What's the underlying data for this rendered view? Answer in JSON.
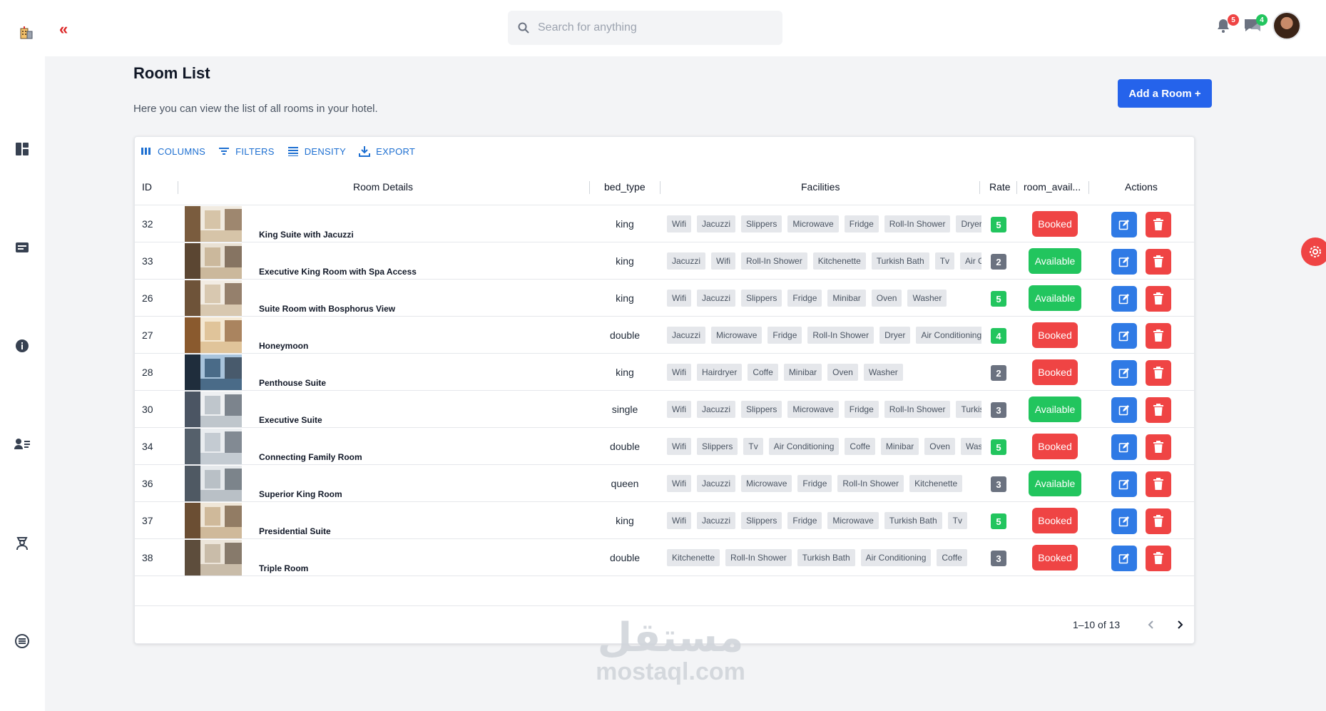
{
  "search": {
    "placeholder": "Search for anything"
  },
  "notifications": {
    "bell_count": "5",
    "chat_count": "4"
  },
  "page": {
    "title": "Room List",
    "subtitle": "Here you can view the list of all rooms in your hotel.",
    "add_button": "Add a Room +"
  },
  "toolbar": {
    "columns": "COLUMNS",
    "filters": "FILTERS",
    "density": "DENSITY",
    "export": "EXPORT"
  },
  "table": {
    "headers": {
      "id": "ID",
      "details": "Room Details",
      "bed": "bed_type",
      "facilities": "Facilities",
      "rate": "Rate",
      "avail": "room_avail...",
      "actions": "Actions"
    },
    "rows": [
      {
        "id": "32",
        "name": "King Suite with Jacuzzi",
        "bed": "king",
        "facilities": [
          "Wifi",
          "Jacuzzi",
          "Slippers",
          "Microwave",
          "Fridge",
          "Roll-In Shower",
          "Dryer"
        ],
        "rate": "5",
        "status": "Booked"
      },
      {
        "id": "33",
        "name": "Executive King Room with Spa Access",
        "bed": "king",
        "facilities": [
          "Jacuzzi",
          "Wifi",
          "Roll-In Shower",
          "Kitchenette",
          "Turkish Bath",
          "Tv",
          "Air Conditioning"
        ],
        "rate": "2",
        "status": "Available"
      },
      {
        "id": "26",
        "name": "Suite Room with Bosphorus View",
        "bed": "king",
        "facilities": [
          "Wifi",
          "Jacuzzi",
          "Slippers",
          "Fridge",
          "Minibar",
          "Oven",
          "Washer"
        ],
        "rate": "5",
        "status": "Available"
      },
      {
        "id": "27",
        "name": "Honeymoon",
        "bed": "double",
        "facilities": [
          "Jacuzzi",
          "Microwave",
          "Fridge",
          "Roll-In Shower",
          "Dryer",
          "Air Conditioning"
        ],
        "rate": "4",
        "status": "Booked"
      },
      {
        "id": "28",
        "name": "Penthouse Suite",
        "bed": "king",
        "facilities": [
          "Wifi",
          "Hairdryer",
          "Coffe",
          "Minibar",
          "Oven",
          "Washer"
        ],
        "rate": "2",
        "status": "Booked"
      },
      {
        "id": "30",
        "name": "Executive Suite",
        "bed": "single",
        "facilities": [
          "Wifi",
          "Jacuzzi",
          "Slippers",
          "Microwave",
          "Fridge",
          "Roll-In Shower",
          "Turkish Bath"
        ],
        "rate": "3",
        "status": "Available"
      },
      {
        "id": "34",
        "name": "Connecting Family Room",
        "bed": "double",
        "facilities": [
          "Wifi",
          "Slippers",
          "Tv",
          "Air Conditioning",
          "Coffe",
          "Minibar",
          "Oven",
          "Washer"
        ],
        "rate": "5",
        "status": "Booked"
      },
      {
        "id": "36",
        "name": "Superior King Room",
        "bed": "queen",
        "facilities": [
          "Wifi",
          "Jacuzzi",
          "Microwave",
          "Fridge",
          "Roll-In Shower",
          "Kitchenette"
        ],
        "rate": "3",
        "status": "Available"
      },
      {
        "id": "37",
        "name": "Presidential Suite",
        "bed": "king",
        "facilities": [
          "Wifi",
          "Jacuzzi",
          "Slippers",
          "Fridge",
          "Microwave",
          "Turkish Bath",
          "Tv"
        ],
        "rate": "5",
        "status": "Booked"
      },
      {
        "id": "38",
        "name": "Triple Room",
        "bed": "double",
        "facilities": [
          "Kitchenette",
          "Roll-In Shower",
          "Turkish Bath",
          "Air Conditioning",
          "Coffe"
        ],
        "rate": "3",
        "status": "Booked"
      }
    ]
  },
  "pagination": {
    "label": "1–10 of 13"
  },
  "watermark": {
    "arabic": "مستقل",
    "latin": "mostaql.com"
  },
  "colors": {
    "accent": "#2563eb",
    "booked": "#ef4444",
    "available": "#22c55e",
    "rate_high": "#22c55e",
    "rate_low": "#6b7280",
    "danger": "#dc2626"
  }
}
